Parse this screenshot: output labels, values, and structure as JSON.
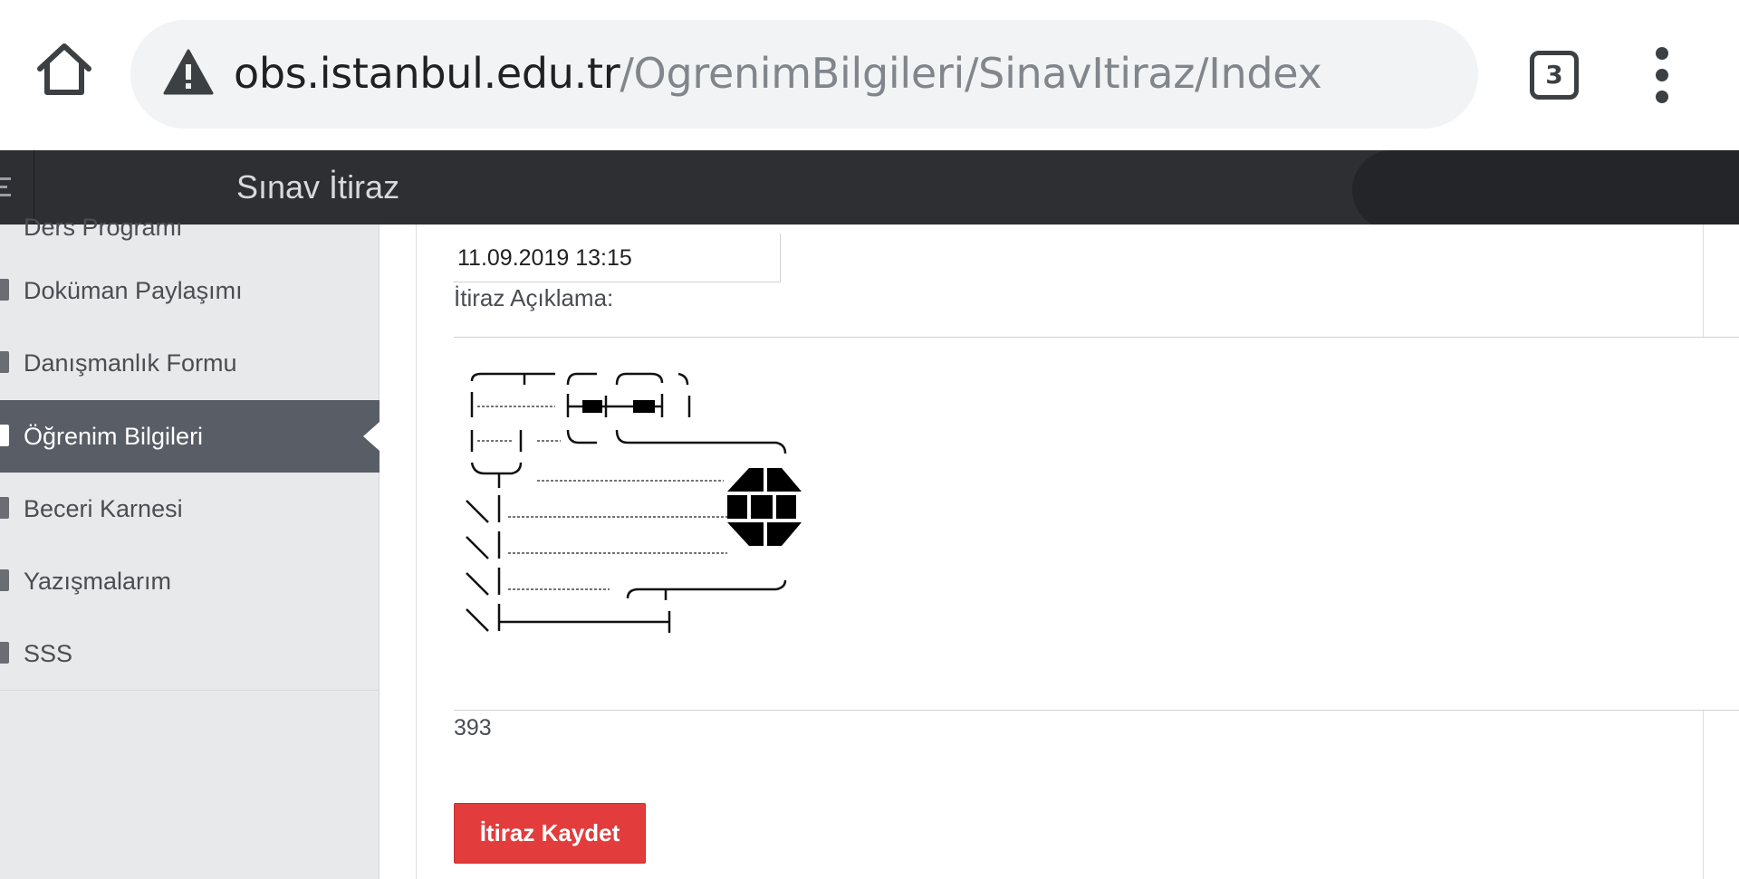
{
  "browser": {
    "url_host": "obs.istanbul.edu.tr",
    "url_path": "/OgrenimBilgileri/SinavItiraz/Index",
    "tab_count": "3",
    "icons": [
      "home-icon",
      "warning-icon",
      "tabs-icon",
      "more-vert-icon"
    ]
  },
  "header": {
    "title": "Sınav İtiraz"
  },
  "sidebar": {
    "items": [
      {
        "label": "Ders Programı",
        "icon": "calendar-icon",
        "active": false,
        "partial": true
      },
      {
        "label": "Doküman Paylaşımı",
        "icon": "document-icon",
        "active": false
      },
      {
        "label": "Danışmanlık Formu",
        "icon": "list-icon",
        "active": false
      },
      {
        "label": "Öğrenim Bilgileri",
        "icon": "edit-icon",
        "active": true
      },
      {
        "label": "Beceri Karnesi",
        "icon": "book-icon",
        "active": false
      },
      {
        "label": "Yazışmalarım",
        "icon": "chat-icon",
        "active": false
      },
      {
        "label": "SSS",
        "icon": "question-icon",
        "active": false
      }
    ]
  },
  "form": {
    "date_value": "11.09.2019 13:15",
    "aciklama_label": "İtiraz Açıklama:",
    "char_count": "393",
    "submit_label": "İtiraz Kaydet"
  },
  "colors": {
    "header_bg": "#2d2f33",
    "sidebar_bg": "#e8e9eb",
    "sidebar_active": "#585d66",
    "button_red": "#e23c3c"
  }
}
